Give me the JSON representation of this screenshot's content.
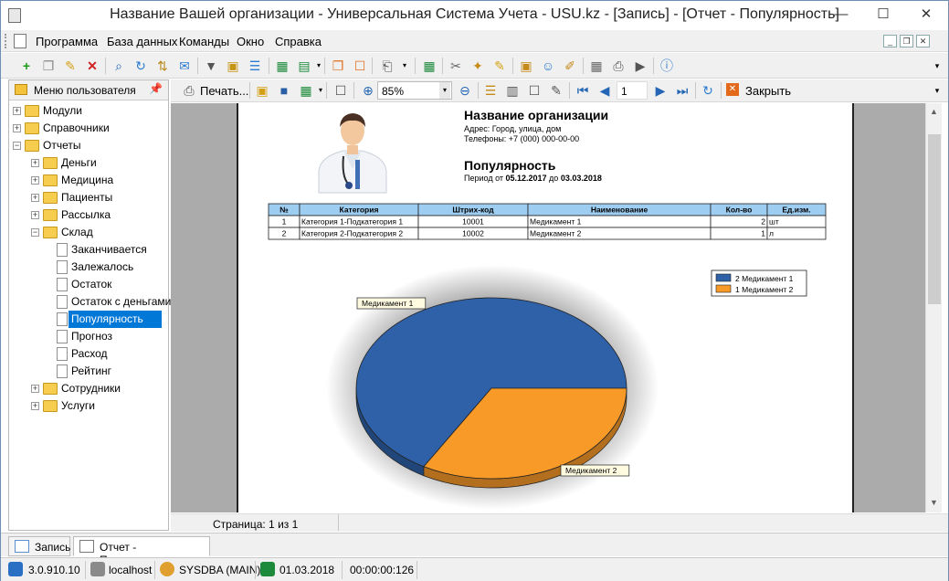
{
  "window": {
    "title": "Название Вашей организации - Универсальная Система Учета - USU.kz - [Запись] - [Отчет - Популярность]"
  },
  "menu": [
    "Программа",
    "База данных",
    "Команды",
    "Окно",
    "Справка"
  ],
  "left_panel": {
    "title": "Меню пользователя"
  },
  "tree": [
    {
      "label": "Модули",
      "level": 0,
      "kind": "folder",
      "expander": "+"
    },
    {
      "label": "Справочники",
      "level": 0,
      "kind": "folder",
      "expander": "+"
    },
    {
      "label": "Отчеты",
      "level": 0,
      "kind": "folder",
      "expander": "−"
    },
    {
      "label": "Деньги",
      "level": 1,
      "kind": "folder",
      "expander": "+"
    },
    {
      "label": "Медицина",
      "level": 1,
      "kind": "folder",
      "expander": "+"
    },
    {
      "label": "Пациенты",
      "level": 1,
      "kind": "folder",
      "expander": "+"
    },
    {
      "label": "Рассылка",
      "level": 1,
      "kind": "folder",
      "expander": "+"
    },
    {
      "label": "Склад",
      "level": 1,
      "kind": "folder",
      "expander": "−"
    },
    {
      "label": "Заканчивается",
      "level": 2,
      "kind": "doc"
    },
    {
      "label": "Залежалось",
      "level": 2,
      "kind": "doc"
    },
    {
      "label": "Остаток",
      "level": 2,
      "kind": "doc"
    },
    {
      "label": "Остаток с деньгами",
      "level": 2,
      "kind": "doc"
    },
    {
      "label": "Популярность",
      "level": 2,
      "kind": "doc",
      "selected": true
    },
    {
      "label": "Прогноз",
      "level": 2,
      "kind": "doc"
    },
    {
      "label": "Расход",
      "level": 2,
      "kind": "doc"
    },
    {
      "label": "Рейтинг",
      "level": 2,
      "kind": "doc"
    },
    {
      "label": "Сотрудники",
      "level": 1,
      "kind": "folder",
      "expander": "+"
    },
    {
      "label": "Услуги",
      "level": 1,
      "kind": "folder",
      "expander": "+"
    }
  ],
  "report_toolbar": {
    "print_label": "Печать...",
    "zoom": "85%",
    "page_value": "1",
    "close_label": "Закрыть"
  },
  "report": {
    "org_name": "Название организации",
    "address": "Адрес: Город, улица, дом",
    "phones": "Телефоны: +7 (000) 000-00-00",
    "title": "Популярность",
    "period_prefix": "Период от ",
    "date_from": "05.12.2017",
    "period_mid": " до ",
    "date_to": "03.03.2018",
    "table": {
      "headers": [
        "№",
        "Категория",
        "Штрих-код",
        "Наименование",
        "Кол-во",
        "Ед.изм."
      ],
      "rows": [
        [
          "1",
          "Категория 1-Подкатегория 1",
          "10001",
          "Медикамент 1",
          "2",
          "шт"
        ],
        [
          "2",
          "Категория 2-Подкатегория 2",
          "10002",
          "Медикамент 2",
          "1",
          "л"
        ]
      ]
    }
  },
  "chart_data": {
    "type": "pie",
    "title": "",
    "labels": [
      "Медикамент 1",
      "Медикамент 2"
    ],
    "values": [
      2,
      1
    ],
    "colors": [
      "#2e61a8",
      "#f89a28"
    ],
    "legend": [
      "2 Медикамент 1",
      "1 Медикамент 2"
    ],
    "legend_position": "top-right"
  },
  "page_status": "Страница: 1 из 1",
  "tabs": [
    {
      "label": "Запись",
      "active": false
    },
    {
      "label": "Отчет - Популярность",
      "active": true
    }
  ],
  "status": {
    "version": "3.0.910.10",
    "server": "localhost",
    "user": "SYSDBA (MAIN)",
    "date": "01.03.2018",
    "timer": "00:00:00:126"
  },
  "colors": {
    "accent": "#0078d7",
    "table_header": "#9dcdf1",
    "preview_bg": "#ababab"
  }
}
